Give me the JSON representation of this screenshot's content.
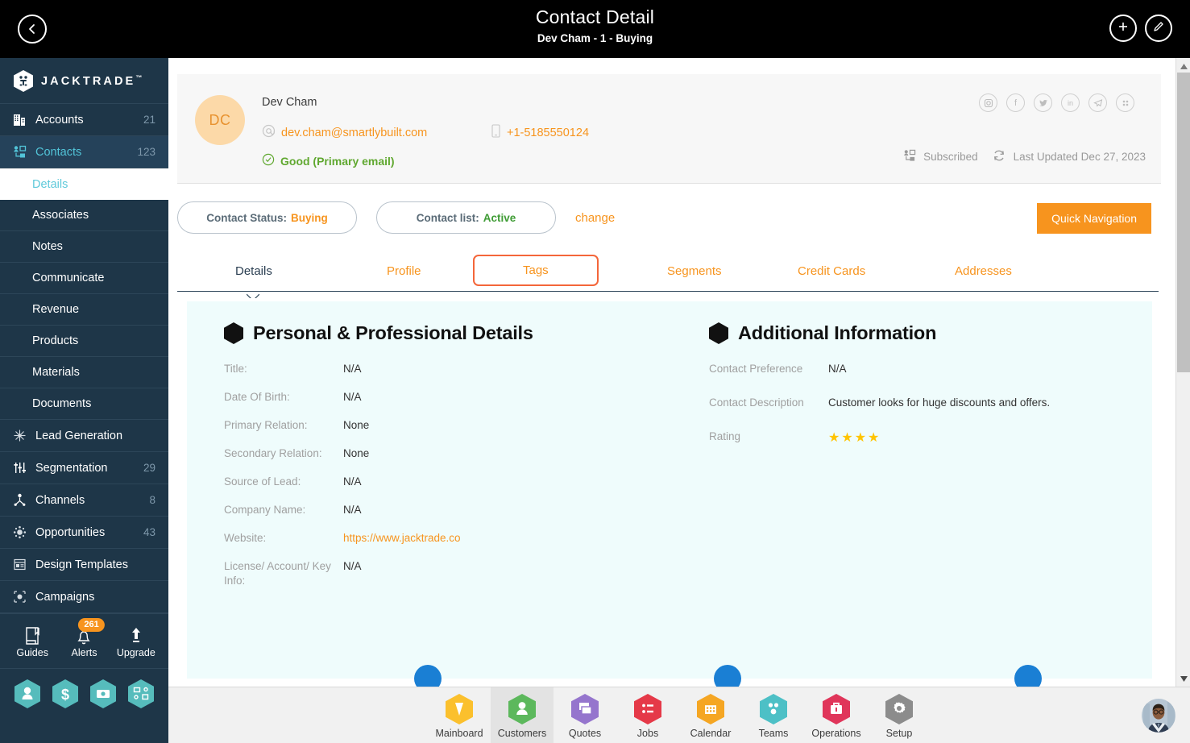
{
  "topbar": {
    "title": "Contact Detail",
    "subtitle": "Dev Cham - 1 - Buying",
    "back_icon": "chevron-left-icon",
    "add_icon": "plus-icon",
    "edit_icon": "pencil-icon"
  },
  "brand": {
    "name": "JACKTRADE",
    "tm": "™"
  },
  "sidebar": {
    "items": [
      {
        "label": "Accounts",
        "count": "21",
        "icon": "building-icon",
        "active": false
      },
      {
        "label": "Contacts",
        "count": "123",
        "icon": "contacts-icon",
        "active": true
      }
    ],
    "sub_items": [
      {
        "label": "Details",
        "current": true
      },
      {
        "label": "Associates",
        "current": false
      },
      {
        "label": "Notes",
        "current": false
      },
      {
        "label": "Communicate",
        "current": false
      },
      {
        "label": "Revenue",
        "current": false
      },
      {
        "label": "Products",
        "current": false
      },
      {
        "label": "Materials",
        "current": false
      },
      {
        "label": "Documents",
        "current": false
      }
    ],
    "items2": [
      {
        "label": "Lead Generation",
        "count": "",
        "icon": "snowflake-icon"
      },
      {
        "label": "Segmentation",
        "count": "29",
        "icon": "segmentation-icon"
      },
      {
        "label": "Channels",
        "count": "8",
        "icon": "channels-icon"
      },
      {
        "label": "Opportunities",
        "count": "43",
        "icon": "opportunities-icon"
      },
      {
        "label": "Design Templates",
        "count": "",
        "icon": "template-icon"
      },
      {
        "label": "Campaigns",
        "count": "",
        "icon": "campaign-icon"
      }
    ],
    "tools": [
      {
        "label": "Guides",
        "icon": "book-icon",
        "badge": ""
      },
      {
        "label": "Alerts",
        "icon": "bell-icon",
        "badge": "261"
      },
      {
        "label": "Upgrade",
        "icon": "arrow-up-icon",
        "badge": ""
      }
    ],
    "hex_buttons": [
      "person-hex-icon",
      "dollar-hex-icon",
      "money-hex-icon",
      "workflow-hex-icon"
    ]
  },
  "contact_card": {
    "initials": "DC",
    "name": "Dev Cham",
    "email": "dev.cham@smartlybuilt.com",
    "email_icon": "at-icon",
    "phone": "+1-5185550124",
    "phone_icon": "mobile-icon",
    "email_status": "Good (Primary email)",
    "email_status_icon": "check-circle-icon",
    "socials": [
      "instagram-icon",
      "facebook-icon",
      "twitter-icon",
      "linkedin-icon",
      "telegram-icon",
      "apps-icon"
    ],
    "subscribed": "Subscribed",
    "subscribed_icon": "contacts-icon",
    "last_updated": "Last Updated Dec 27, 2023",
    "refresh_icon": "refresh-icon"
  },
  "status_bar": {
    "contact_status_label": "Contact Status:",
    "contact_status_value": "Buying",
    "contact_list_label": "Contact list:",
    "contact_list_value": "Active",
    "change_label": "change",
    "quick_nav_label": "Quick Navigation"
  },
  "tabs": [
    {
      "label": "Details",
      "active": true,
      "boxed": false
    },
    {
      "label": "Profile",
      "active": false,
      "boxed": false
    },
    {
      "label": "Tags",
      "active": false,
      "boxed": true
    },
    {
      "label": "Segments",
      "active": false,
      "boxed": false
    },
    {
      "label": "Credit Cards",
      "active": false,
      "boxed": false
    },
    {
      "label": "Addresses",
      "active": false,
      "boxed": false
    }
  ],
  "panel": {
    "left": {
      "title": "Personal & Professional Details",
      "fields": [
        {
          "label": "Title:",
          "value": "N/A",
          "link": false
        },
        {
          "label": "Date Of Birth:",
          "value": "N/A",
          "link": false
        },
        {
          "label": "Primary Relation:",
          "value": "None",
          "link": false
        },
        {
          "label": "Secondary Relation:",
          "value": "None",
          "link": false
        },
        {
          "label": "Source of Lead:",
          "value": "N/A",
          "link": false
        },
        {
          "label": "Company Name:",
          "value": "N/A",
          "link": false
        },
        {
          "label": "Website:",
          "value": "https://www.jacktrade.co",
          "link": true
        },
        {
          "label": "License/ Account/ Key Info:",
          "value": "N/A",
          "link": false
        }
      ]
    },
    "right": {
      "title": "Additional Information",
      "fields": [
        {
          "label": "Contact Preference",
          "value": "N/A",
          "link": false
        },
        {
          "label": "Contact Description",
          "value": "Customer looks for huge discounts and offers.",
          "link": false
        }
      ],
      "rating_label": "Rating",
      "rating_stars": "★★★★",
      "rating_value": 4
    }
  },
  "taskbar": {
    "items": [
      {
        "label": "Mainboard",
        "color": "#fbc02d",
        "icon": "mainboard-icon",
        "selected": false
      },
      {
        "label": "Customers",
        "color": "#5cb85c",
        "icon": "customers-icon",
        "selected": true
      },
      {
        "label": "Quotes",
        "color": "#9575cd",
        "icon": "quotes-icon",
        "selected": false
      },
      {
        "label": "Jobs",
        "color": "#e53948",
        "icon": "jobs-icon",
        "selected": false
      },
      {
        "label": "Calendar",
        "color": "#f5a623",
        "icon": "calendar-icon",
        "selected": false
      },
      {
        "label": "Teams",
        "color": "#4dc0c6",
        "icon": "teams-icon",
        "selected": false
      },
      {
        "label": "Operations",
        "color": "#e0355a",
        "icon": "operations-icon",
        "selected": false
      },
      {
        "label": "Setup",
        "color": "#8c8c8c",
        "icon": "gear-icon",
        "selected": false
      }
    ],
    "avatar": "user-avatar"
  },
  "scrollbar": {
    "up_icon": "caret-up-icon",
    "down_icon": "caret-down-icon"
  },
  "colors": {
    "accent_orange": "#f7941e",
    "highlight_orange": "#f4663a",
    "sidebar_bg": "#1e3648",
    "panel_bg": "#effcfc",
    "teal": "#52c4d8",
    "green": "#60a830",
    "star_yellow": "#ffc400"
  }
}
